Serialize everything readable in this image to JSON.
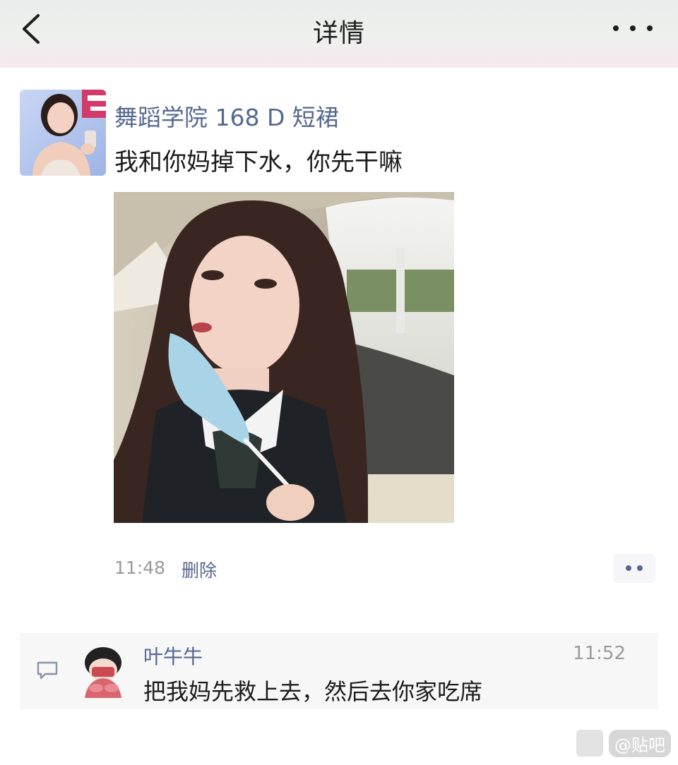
{
  "header": {
    "title": "详情",
    "back_icon": "chevron-left-icon",
    "more_icon": "more-horizontal-icon"
  },
  "post": {
    "username": "舞蹈学院 168 D 短裙",
    "text": "我和你妈掉下水，你先干嘛",
    "time": "11:48",
    "delete_label": "删除",
    "action_icon": "comment-like-dots-icon"
  },
  "comment": {
    "icon": "comment-bubble-icon",
    "author": "叶牛牛",
    "time": "11:52",
    "text": "把我妈先救上去，然后去你家吃席"
  },
  "watermark": {
    "text": "@贴吧"
  },
  "colors": {
    "link": "#55688f",
    "text": "#1b1b1b",
    "muted": "#9a9a9a",
    "comment_bg": "#f7f7f8"
  }
}
